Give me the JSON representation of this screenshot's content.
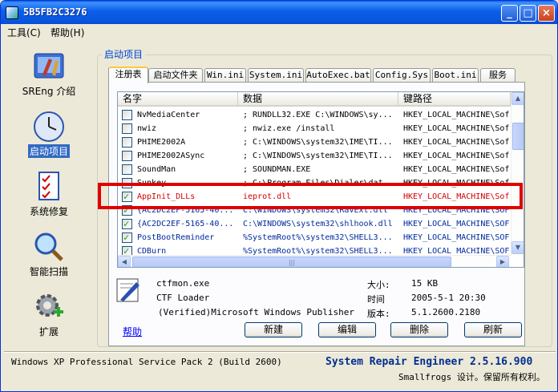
{
  "window": {
    "title": "5B5FB2C3276"
  },
  "menu": [
    {
      "label": "工具(C)"
    },
    {
      "label": "帮助(H)"
    }
  ],
  "nav": [
    {
      "label": "SREng 介绍",
      "icon": "tools-icon"
    },
    {
      "label": "启动项目",
      "icon": "clock-icon"
    },
    {
      "label": "系统修复",
      "icon": "checklist-icon"
    },
    {
      "label": "智能扫描",
      "icon": "magnifier-icon"
    },
    {
      "label": "扩展",
      "icon": "gear-plus-icon"
    }
  ],
  "group_title": "启动项目",
  "tabs": [
    {
      "label": "注册表"
    },
    {
      "label": "启动文件夹"
    },
    {
      "label": "Win.ini"
    },
    {
      "label": "System.ini"
    },
    {
      "label": "AutoExec.bat"
    },
    {
      "label": "Config.Sys"
    },
    {
      "label": "Boot.ini"
    },
    {
      "label": "服务"
    }
  ],
  "list": {
    "headers": [
      "名字",
      "数据",
      "键路径"
    ],
    "rows": [
      {
        "name": "NvMediaCenter",
        "data": "; RUNDLL32.EXE C:\\WINDOWS\\sy...",
        "path": "HKEY_LOCAL_MACHINE\\Sof",
        "checked": false,
        "style": ""
      },
      {
        "name": "nwiz",
        "data": "; nwiz.exe /install",
        "path": "HKEY_LOCAL_MACHINE\\Sof",
        "checked": false,
        "style": ""
      },
      {
        "name": "PHIME2002A",
        "data": "; C:\\WINDOWS\\system32\\IME\\TI...",
        "path": "HKEY_LOCAL_MACHINE\\Sof",
        "checked": false,
        "style": ""
      },
      {
        "name": "PHIME2002ASync",
        "data": "; C:\\WINDOWS\\system32\\IME\\TI...",
        "path": "HKEY_LOCAL_MACHINE\\Sof",
        "checked": false,
        "style": ""
      },
      {
        "name": "SoundMan",
        "data": "; SOUNDMAN.EXE",
        "path": "HKEY_LOCAL_MACHINE\\Sof",
        "checked": false,
        "style": ""
      },
      {
        "name": "Sunkey",
        "data": "; C:\\Program Files\\Dialer\\dat...",
        "path": "HKEY_LOCAL_MACHINE\\Sof",
        "checked": false,
        "style": ""
      },
      {
        "name": "AppInit_DLLs",
        "data": "ieprot.dll",
        "path": "HKEY_LOCAL_MACHINE\\Sof",
        "checked": true,
        "style": "red"
      },
      {
        "name": "{AC2DC2EF-5165-40...",
        "data": "C:\\WINDOWS\\system32\\RavExt.dll",
        "path": "HKEY_LOCAL_MACHINE\\SOF",
        "checked": true,
        "style": "blue"
      },
      {
        "name": "{AC2DC2EF-5165-40...",
        "data": "C:\\WINDOWS\\system32\\shlhook.dll",
        "path": "HKEY_LOCAL_MACHINE\\SOF",
        "checked": true,
        "style": "blue"
      },
      {
        "name": "PostBootReminder",
        "data": "%SystemRoot%\\system32\\SHELL3...",
        "path": "HKEY_LOCAL_MACHINE\\SOF",
        "checked": true,
        "style": "blue"
      },
      {
        "name": "CDBurn",
        "data": "%SystemRoot%\\system32\\SHELL3...",
        "path": "HKEY_LOCAL_MACHINE\\SOF",
        "checked": true,
        "style": "blue"
      }
    ]
  },
  "details": {
    "file": "ctfmon.exe",
    "description": "CTF Loader",
    "publisher": "(Verified)Microsoft Windows Publisher",
    "size_label": "大小:",
    "size_value": "15 KB",
    "time_label": "时间",
    "time_value": "2005-5-1 20:30",
    "version_label": "版本:",
    "version_value": "5.1.2600.2180"
  },
  "buttons": {
    "help": "帮助",
    "new": "新建",
    "edit": "编辑",
    "delete": "删除",
    "refresh": "刷新"
  },
  "status": {
    "os": "Windows XP Professional Service Pack 2 (Build 2600)",
    "product": "System Repair Engineer 2.5.16.900",
    "copyright": "Smallfrogs 设计。保留所有权利。"
  }
}
